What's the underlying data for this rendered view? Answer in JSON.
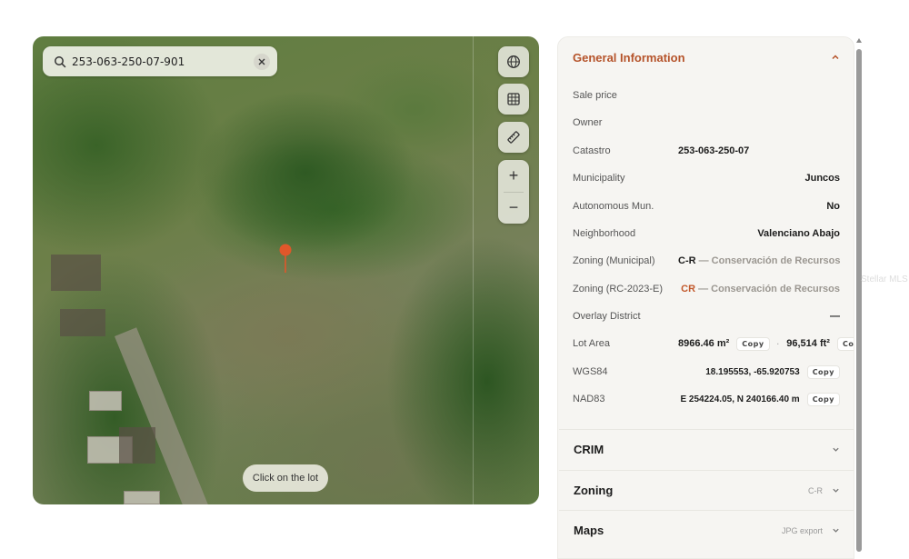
{
  "map": {
    "search_value": "253-063-250-07-901",
    "click_hint": "Click on the lot",
    "zoom_in": "+",
    "zoom_out": "−"
  },
  "general_info": {
    "title": "General Information",
    "sale_price_label": "Sale price",
    "sale_price_value": "",
    "owner_label": "Owner",
    "owner_value": "",
    "catastro_label": "Catastro",
    "catastro_value": "253-063-250-07",
    "municipality_label": "Municipality",
    "municipality_value": "Juncos",
    "autonomous_label": "Autonomous Mun.",
    "autonomous_value": "No",
    "neighborhood_label": "Neighborhood",
    "neighborhood_value": "Valenciano Abajo",
    "zoning_municipal_label": "Zoning (Municipal)",
    "zoning_municipal_code": "C-R",
    "zoning_municipal_desc": " — Conservación de Recursos",
    "zoning_rc_label": "Zoning (RC-2023-E)",
    "zoning_rc_code": "CR",
    "zoning_rc_desc": " — Conservación de Recursos",
    "overlay_label": "Overlay District",
    "overlay_value": "—",
    "lot_area_label": "Lot Area",
    "lot_area_m2": "8966.46 m²",
    "lot_area_ft2": "96,514 ft²",
    "separator": "·",
    "wgs84_label": "WGS84",
    "wgs84_value": "18.195553, -65.920753",
    "nad83_label": "NAD83",
    "nad83_value": "E 254224.05, N 240166.40 m",
    "copy_label": "Copy"
  },
  "sections": [
    {
      "title": "CRIM",
      "tag": ""
    },
    {
      "title": "Zoning",
      "tag": "C-R"
    },
    {
      "title": "Maps",
      "tag": "JPG export"
    }
  ],
  "watermark": "Stellar MLS",
  "colors": {
    "accent": "#b5532a",
    "pin": "#e0572a",
    "panel_bg": "#f6f5f2"
  }
}
